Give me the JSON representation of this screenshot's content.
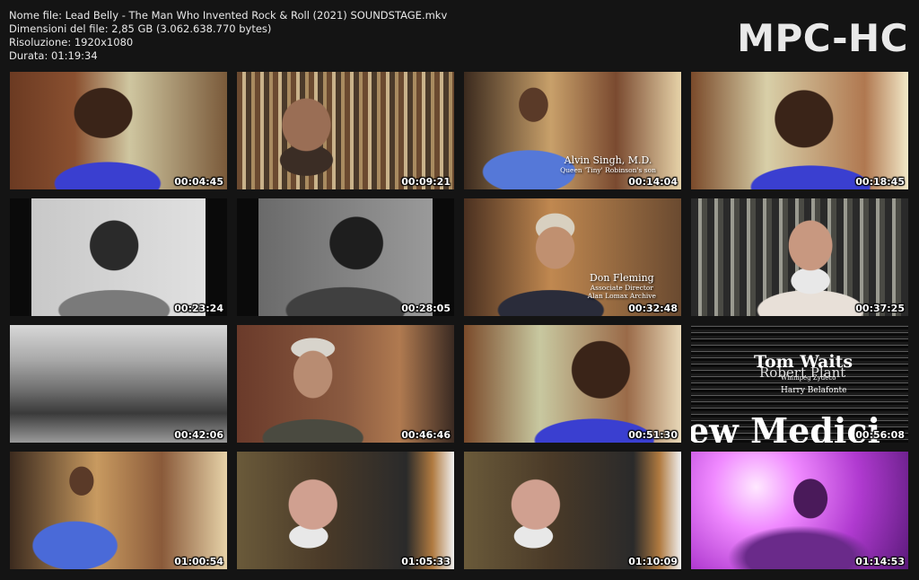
{
  "file_info": {
    "name": "Nome file: Lead Belly - The Man Who Invented Rock & Roll (2021) SOUNDSTAGE.mkv",
    "size": "Dimensioni del file: 2,85 GB (3.062.638.770 bytes)",
    "resolution": "Risoluzione: 1920x1080",
    "duration": "Durata: 01:19:34"
  },
  "brand": "MPC-HC",
  "thumbnails": [
    {
      "time": "00:04:45",
      "scene": "elderly-woman-purple-jacket"
    },
    {
      "time": "00:09:21",
      "scene": "bearded-man-bookshelf"
    },
    {
      "time": "00:14:04",
      "scene": "man-blue-shirt-interview",
      "caption": {
        "name": "Alvin Singh, M.D.",
        "sub": [
          "Queen 'Tiny' Robinson's son"
        ]
      }
    },
    {
      "time": "00:18:45",
      "scene": "elderly-woman-closeup"
    },
    {
      "time": "00:23:24",
      "scene": "archival-bw-portrait"
    },
    {
      "time": "00:28:05",
      "scene": "archival-bw-bowtie"
    },
    {
      "time": "00:32:48",
      "scene": "man-glasses-interview",
      "caption": {
        "name": "Don Fleming",
        "sub": [
          "Associate Director",
          "Alan Lomax Archive"
        ]
      }
    },
    {
      "time": "00:37:25",
      "scene": "white-haired-man-singing"
    },
    {
      "time": "00:42:06",
      "scene": "archival-bw-war"
    },
    {
      "time": "00:46:46",
      "scene": "grey-haired-man-glasses"
    },
    {
      "time": "00:51:30",
      "scene": "elderly-woman-hand-chin"
    },
    {
      "time": "00:56:08",
      "scene": "title-card",
      "title_card": {
        "line1": "Tom Waits",
        "line2": "Robert Plant",
        "small": "Winnipeg Zydeco",
        "line3": "Harry Belafonte",
        "bottom": "ew Medici"
      }
    },
    {
      "time": "01:00:54",
      "scene": "man-blue-shirt-wide"
    },
    {
      "time": "01:05:33",
      "scene": "elderly-man-guitar"
    },
    {
      "time": "01:10:09",
      "scene": "elderly-man-guitar-2"
    },
    {
      "time": "01:14:53",
      "scene": "purple-silhouette-guitar"
    }
  ]
}
